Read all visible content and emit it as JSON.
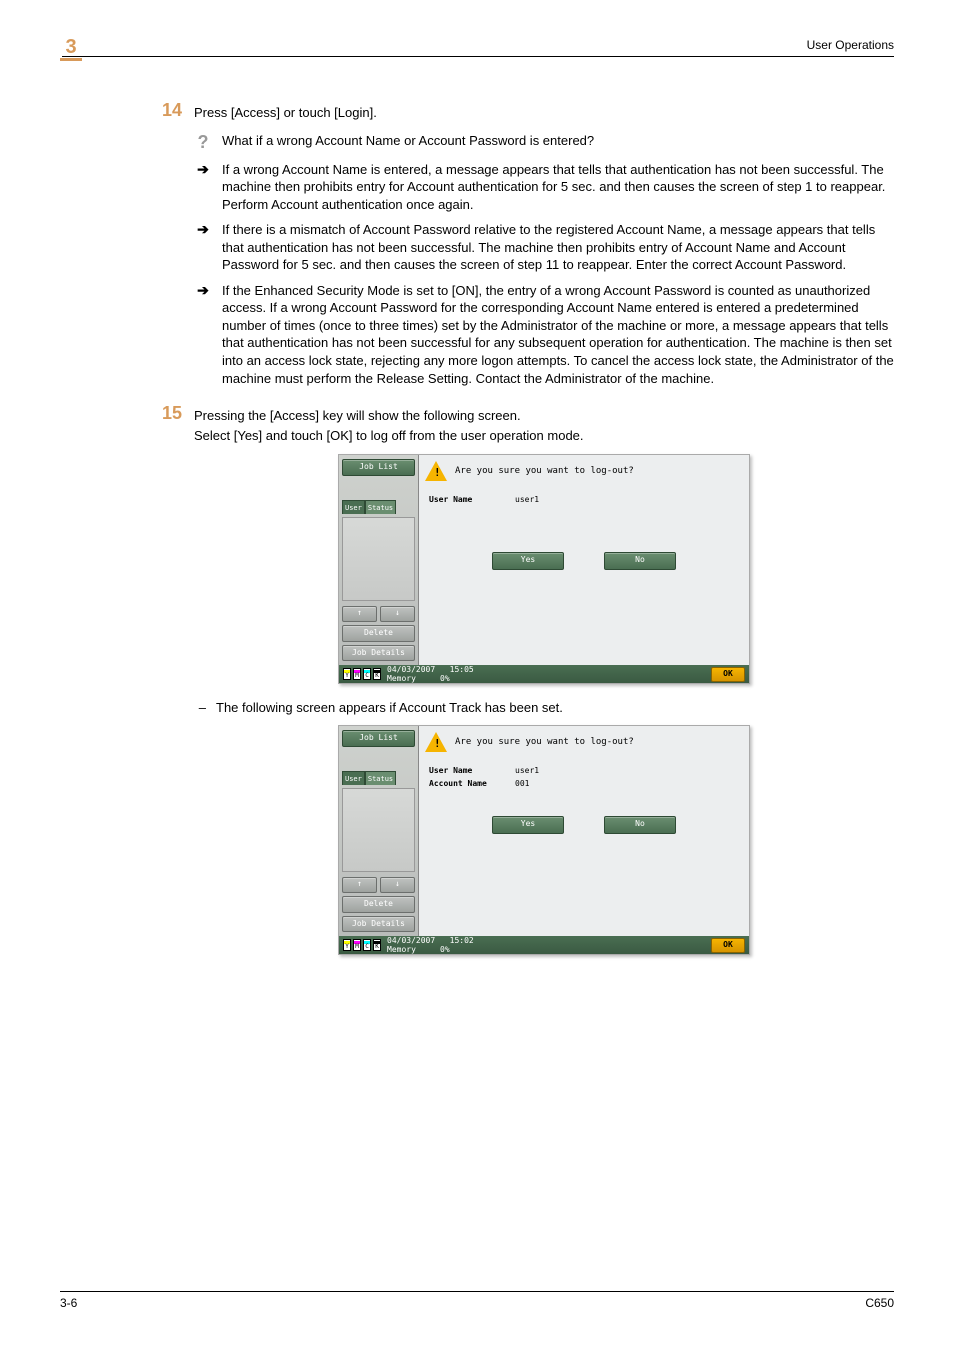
{
  "header": {
    "section": "3",
    "title": "User Operations"
  },
  "steps": {
    "s14": {
      "num": "14",
      "main": "Press [Access] or touch [Login].",
      "q": "What if a wrong Account Name or Account Password is entered?",
      "b1": "If a wrong Account Name is entered, a message appears that tells that authentication has not been successful. The machine then prohibits entry for Account authentication for 5 sec. and then causes the screen of step 1 to reappear. Perform Account authentication once again.",
      "b2": "If there is a mismatch of Account Password relative to the registered Account Name, a message appears that tells that authentication has not been successful. The machine then prohibits entry of Account Name and Account Password for 5 sec. and then causes the screen of step 11 to reappear. Enter the correct Account Password.",
      "b3": "If the Enhanced Security Mode is set to [ON], the entry of a wrong Account Password is counted as unauthorized access. If a wrong Account Password for the corresponding Account Name entered is entered a predetermined number of times (once to three times) set by the Administrator of the machine or more, a message appears that tells that authentication has not been successful for any subsequent operation for authentication. The machine is then set into an access lock state, rejecting any more logon attempts. To cancel the access lock state, the Administrator of the machine must perform the Release Setting. Contact the Administrator of the machine."
    },
    "s15": {
      "num": "15",
      "l1": "Pressing the [Access] key will show the following screen.",
      "l2": "Select [Yes] and touch [OK] to log off from the user operation mode.",
      "after": "The following screen appears if Account Track has been set."
    }
  },
  "screen_labels": {
    "job_list": "Job List",
    "user_name_tab": "User\nName",
    "status_tab": "Status",
    "delete": "Delete",
    "job_details": "Job Details",
    "prompt": "Are you sure you want to log-out?",
    "user_name": "User Name",
    "account_name": "Account Name",
    "yes": "Yes",
    "no": "No",
    "ok": "OK",
    "memory": "Memory",
    "mem_pct": "0%"
  },
  "screen1": {
    "user": "user1",
    "date": "04/03/2007",
    "time": "15:05"
  },
  "screen2": {
    "user": "user1",
    "account": "001",
    "date": "04/03/2007",
    "time": "15:02"
  },
  "footer": {
    "left": "3-6",
    "right": "C650"
  }
}
